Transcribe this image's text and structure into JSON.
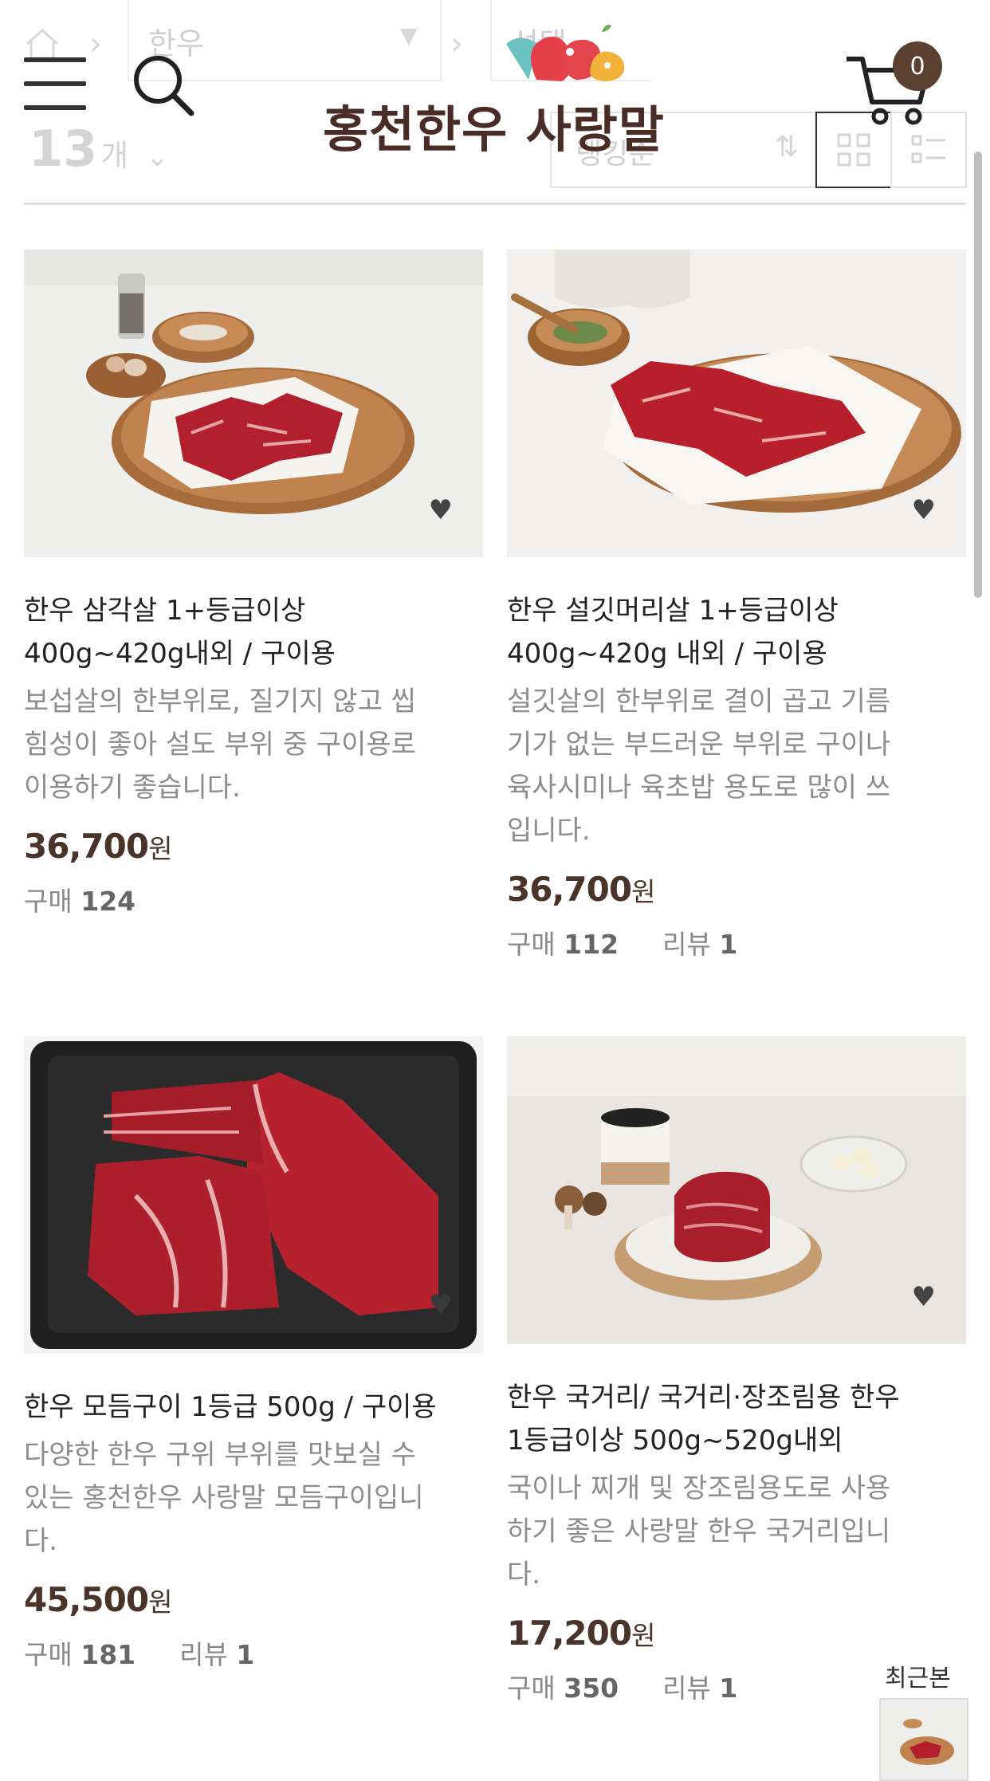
{
  "header": {
    "logo_text": "홍천한우 사랑말",
    "cart_count": "0"
  },
  "underlay": {
    "breadcrumb": [
      "한우",
      "선택"
    ],
    "count_number": "13",
    "count_unit": "개",
    "sort_label": "랭킹순"
  },
  "products": [
    {
      "title_line1": "한우 삼각살 1+등급이상",
      "title_line2": "400g~420g내외 / 구이용",
      "desc": [
        "보섭살의 한부위로, 질기지 않고 씹",
        "힘성이 좋아 설도 부위 중 구이용로",
        "이용하기 좋습니다."
      ],
      "price": "36,700",
      "currency": "원",
      "buy_label": "구매",
      "buy_count": "124",
      "review_label": "",
      "review_count": ""
    },
    {
      "title_line1": "한우 설깃머리살 1+등급이상",
      "title_line2": "400g~420g 내외 / 구이용",
      "desc": [
        "설깃살의 한부위로 결이 곱고 기름",
        "기가 없는 부드러운 부위로 구이나",
        "육사시미나 육초밥 용도로 많이 쓰",
        "입니다."
      ],
      "price": "36,700",
      "currency": "원",
      "buy_label": "구매",
      "buy_count": "112",
      "review_label": "리뷰",
      "review_count": "1"
    },
    {
      "title_line1": "한우 모듬구이 1등급 500g / 구이용",
      "title_line2": "",
      "desc": [
        "다양한 한우 구위 부위를 맛보실 수",
        "있는 홍천한우 사랑말 모듬구이입니",
        "다."
      ],
      "price": "45,500",
      "currency": "원",
      "buy_label": "구매",
      "buy_count": "181",
      "review_label": "리뷰",
      "review_count": "1"
    },
    {
      "title_line1": "한우 국거리/ 국거리·장조림용 한우",
      "title_line2": "1등급이상 500g~520g내외",
      "desc": [
        "국이나 찌개 및 장조림용도로 사용",
        "하기 좋은 사랑말 한우 국거리입니",
        "다."
      ],
      "price": "17,200",
      "currency": "원",
      "buy_label": "구매",
      "buy_count": "350",
      "review_label": "리뷰",
      "review_count": "1"
    }
  ],
  "recent": {
    "label": "최근본"
  },
  "icons": [
    "home-icon",
    "menu-icon",
    "search-icon",
    "cart-icon",
    "heart-icon",
    "chevron-down-icon",
    "sort-icon",
    "grid-view-icon",
    "list-view-icon"
  ],
  "colors": {
    "brand_brown": "#4a2c26",
    "price_brown": "#4a3429",
    "badge": "#5b3f30"
  }
}
